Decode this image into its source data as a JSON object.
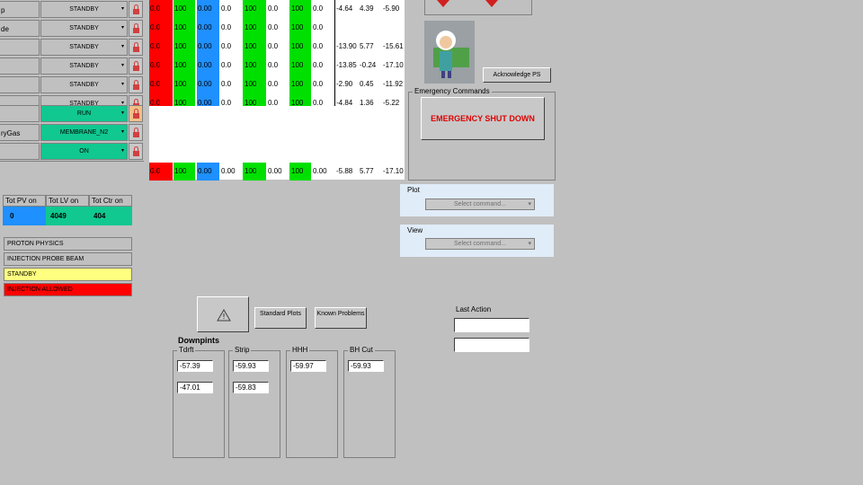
{
  "rows": [
    {
      "label": "p",
      "state": "STANDBY"
    },
    {
      "label": "de",
      "state": "STANDBY"
    },
    {
      "label": "",
      "state": "STANDBY"
    },
    {
      "label": "",
      "state": "STANDBY"
    },
    {
      "label": "",
      "state": "STANDBY"
    },
    {
      "label": "",
      "state": "STANDBY"
    }
  ],
  "rows2": [
    {
      "label": "",
      "state": "RUN"
    },
    {
      "label": "ryGas",
      "state": "MEMBRANE_N2"
    },
    {
      "label": "",
      "state": "ON"
    }
  ],
  "grid_rows": [
    {
      "c1": "0.0",
      "c2": "100",
      "c3": "0.00",
      "c4": "0.0",
      "c5": "100",
      "c6": "0.0",
      "c7": "100",
      "c8": "0.0",
      "c9": "-4.64",
      "c10": "4.39",
      "c11": "-5.90"
    },
    {
      "c1": "0.0",
      "c2": "100",
      "c3": "0.00",
      "c4": "0.0",
      "c5": "100",
      "c6": "0.0",
      "c7": "100",
      "c8": "0.0",
      "c9": "",
      "c10": "",
      "c11": ""
    },
    {
      "c1": "0.0",
      "c2": "100",
      "c3": "0.00",
      "c4": "0.0",
      "c5": "100",
      "c6": "0.0",
      "c7": "100",
      "c8": "0.0",
      "c9": "-13.90",
      "c10": "5.77",
      "c11": "-15.61"
    },
    {
      "c1": "0.0",
      "c2": "100",
      "c3": "0.00",
      "c4": "0.0",
      "c5": "100",
      "c6": "0.0",
      "c7": "100",
      "c8": "0.0",
      "c9": "-13.85",
      "c10": "-0.24",
      "c11": "-17.10"
    },
    {
      "c1": "0.0",
      "c2": "100",
      "c3": "0.00",
      "c4": "0.0",
      "c5": "100",
      "c6": "0.0",
      "c7": "100",
      "c8": "0.0",
      "c9": "-2.90",
      "c10": "0.45",
      "c11": "-11.92"
    },
    {
      "c1": "0.0",
      "c2": "100",
      "c3": "0.00",
      "c4": "0.0",
      "c5": "100",
      "c6": "0.0",
      "c7": "100",
      "c8": "0.0",
      "c9": "-4.84",
      "c10": "1.36",
      "c11": "-5.22"
    }
  ],
  "summary_row": {
    "c1": "0.0",
    "c2": "100",
    "c3": "0.00",
    "c4": "0.00",
    "c5": "100",
    "c6": "0.00",
    "c7": "100",
    "c8": "0.00",
    "c9": "-5.88",
    "c10": "5.77",
    "c11": "-17.10"
  },
  "totals": {
    "headers": [
      "Tot PV on",
      "Tot LV on",
      "Tot Ctr on"
    ],
    "values": [
      "0",
      "4049",
      "404"
    ]
  },
  "status_lines": [
    {
      "text": "PROTON PHYSICS",
      "color": "#c0c0c0"
    },
    {
      "text": "INJECTION PROBE BEAM",
      "color": "#c0c0c0"
    },
    {
      "text": "STANDBY",
      "color": "#ffff80"
    },
    {
      "text": "INJECTION ALLOWED",
      "color": "#ff0000"
    }
  ],
  "acknowledge_label": "Acknowledge PS",
  "emergency_group_title": "Emergency Commands",
  "emergency_button": "EMERGENCY SHUT DOWN",
  "plot": {
    "title": "Plot",
    "placeholder": "Select command..."
  },
  "view": {
    "title": "View",
    "placeholder": "Select command..."
  },
  "buttons": {
    "standard_plots": "Standard Plots",
    "known_problems": "Known Problems"
  },
  "last_action_label": "Last Action",
  "setpoints": {
    "title": "Downpints",
    "groups": [
      {
        "title": "Tdrft",
        "values": [
          "-57.39",
          "-47.01"
        ]
      },
      {
        "title": "Strip",
        "values": [
          "-59.93",
          "-59.83"
        ]
      },
      {
        "title": "HHH",
        "values": [
          "-59.97"
        ]
      },
      {
        "title": "BH Cut",
        "values": [
          "-59.93"
        ]
      }
    ]
  },
  "colors": {
    "red": "#ff0000",
    "green": "#00e000",
    "blue": "#1e90ff",
    "teal": "#10c890",
    "emergency_text": "#e00000"
  }
}
